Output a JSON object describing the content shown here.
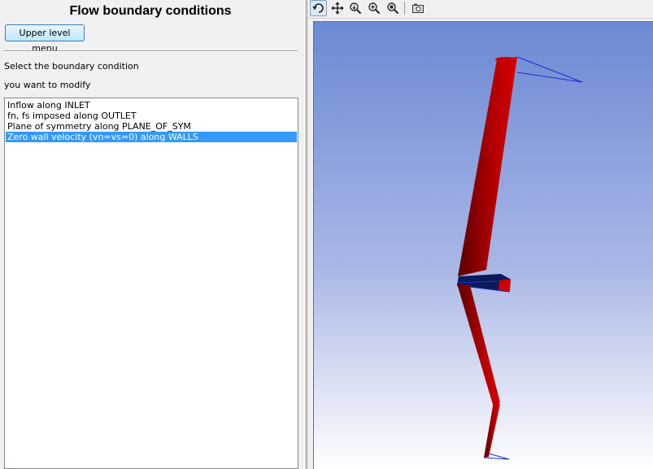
{
  "panel": {
    "title": "Flow boundary conditions",
    "upper_level_button": "Upper level menu",
    "instruction_line1": "Select the boundary condition",
    "instruction_line2": "you want to modify",
    "conditions": [
      {
        "label": "Inflow along INLET",
        "selected": false
      },
      {
        "label": "fn, fs imposed along OUTLET",
        "selected": false
      },
      {
        "label": "Plane of symmetry along PLANE_OF_SYM",
        "selected": false
      },
      {
        "label": "Zero wall velocity (vn=vs=0) along WALLS",
        "selected": true
      }
    ]
  },
  "toolbar": {
    "tools": [
      "rotate-icon",
      "pan-icon",
      "zoom-icon",
      "zoom-in-icon",
      "zoom-fit-icon",
      "camera-icon"
    ],
    "active_tool": "rotate-icon"
  },
  "colors": {
    "selection": "#3399ff",
    "viewport_top": "#6b89d4",
    "viewport_bottom": "#ffffff",
    "geometry_wall": "#cc0000",
    "geometry_edge": "#0000cc"
  }
}
